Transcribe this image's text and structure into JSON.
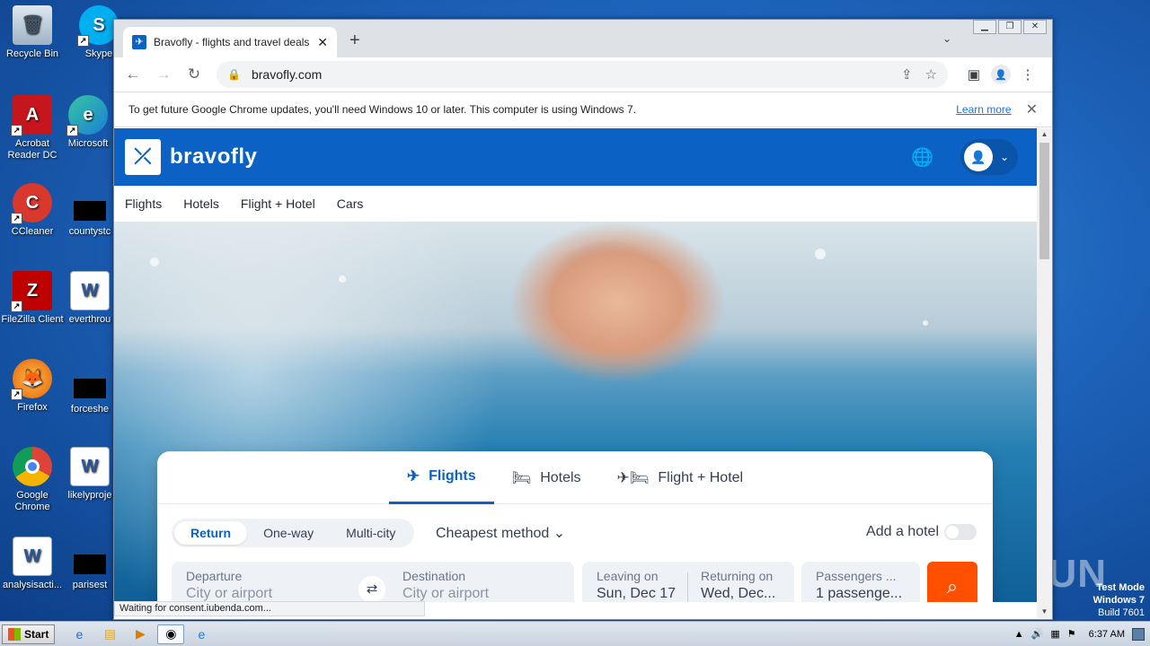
{
  "desktop": {
    "icons": [
      {
        "label": "Recycle Bin",
        "glyph": "🗑"
      },
      {
        "label": "Skype",
        "glyph": "S"
      },
      {
        "label": "Acrobat Reader DC",
        "glyph": "A"
      },
      {
        "label": "Microsoft",
        "glyph": "e"
      },
      {
        "label": "CCleaner",
        "glyph": "C"
      },
      {
        "label": "countystc",
        "glyph": ""
      },
      {
        "label": "FileZilla Client",
        "glyph": "Z"
      },
      {
        "label": "everthrou",
        "glyph": "W"
      },
      {
        "label": "Firefox",
        "glyph": "🦊"
      },
      {
        "label": "forceshe",
        "glyph": ""
      },
      {
        "label": "Google Chrome",
        "glyph": "◉"
      },
      {
        "label": "likelyproje",
        "glyph": "W"
      },
      {
        "label": "analysisacti...",
        "glyph": "W"
      },
      {
        "label": "parisest",
        "glyph": ""
      }
    ],
    "watermark": "ANY RUN",
    "test_mode": [
      "Test Mode",
      "Windows 7",
      "Build 7601"
    ]
  },
  "browser": {
    "tab_title": "Bravofly - flights and travel deals ar",
    "new_tab": "+",
    "url": "bravofly.com",
    "infobar": {
      "message": "To get future Google Chrome updates, you'll need Windows 10 or later. This computer is using Windows 7.",
      "link": "Learn more"
    },
    "status": "Waiting for consent.iubenda.com..."
  },
  "site": {
    "logo": "bravofly",
    "nav": [
      "Flights",
      "Hotels",
      "Flight + Hotel",
      "Cars"
    ],
    "products": [
      {
        "label": "Flights",
        "icon": "plane-icon"
      },
      {
        "label": "Hotels",
        "icon": "bed-icon"
      },
      {
        "label": "Flight + Hotel",
        "icon": "plane-bed-icon"
      }
    ],
    "trip_types": [
      "Return",
      "One-way",
      "Multi-city"
    ],
    "method": "Cheapest method",
    "add_hotel": "Add a hotel",
    "departure": {
      "label": "Departure",
      "placeholder": "City or airport"
    },
    "destination": {
      "label": "Destination",
      "placeholder": "City or airport"
    },
    "leaving": {
      "label": "Leaving on",
      "value": "Sun, Dec 17"
    },
    "returning": {
      "label": "Returning on",
      "value": "Wed, Dec..."
    },
    "passengers": {
      "label": "Passengers ...",
      "value": "1 passenge..."
    }
  },
  "taskbar": {
    "start": "Start",
    "time": "6:37 AM"
  }
}
